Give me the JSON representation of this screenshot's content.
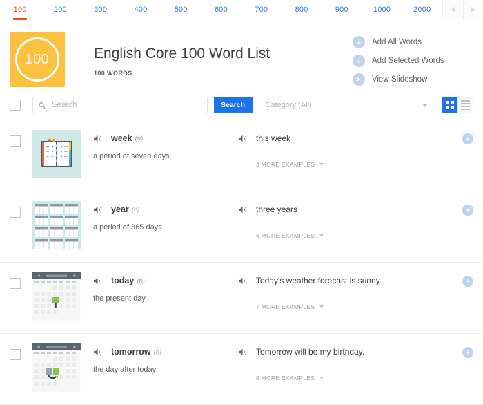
{
  "tabs": {
    "items": [
      {
        "label": "100",
        "active": true
      },
      {
        "label": "200",
        "active": false
      },
      {
        "label": "300",
        "active": false
      },
      {
        "label": "400",
        "active": false
      },
      {
        "label": "500",
        "active": false
      },
      {
        "label": "600",
        "active": false
      },
      {
        "label": "700",
        "active": false
      },
      {
        "label": "800",
        "active": false
      },
      {
        "label": "900",
        "active": false
      },
      {
        "label": "1000",
        "active": false
      },
      {
        "label": "2000",
        "active": false
      }
    ],
    "prev_icon": "chevron-left-icon",
    "next_icon": "chevron-right-icon"
  },
  "header": {
    "badge_number": "100",
    "title": "English Core 100 Word List",
    "word_count": "100 WORDS",
    "actions": [
      {
        "icon": "plus-icon",
        "label": "Add All Words"
      },
      {
        "icon": "plus-icon",
        "label": "Add Selected Words"
      },
      {
        "icon": "play-icon",
        "label": "View Slideshow"
      }
    ]
  },
  "toolbar": {
    "select_all_checkbox": "",
    "search_placeholder": "Search",
    "search_value": "",
    "search_button": "Search",
    "category_value": "Category (All)",
    "grid_view_label": "grid-view",
    "list_view_label": "list-view",
    "active_view": "grid"
  },
  "colors": {
    "accent_orange": "#f4511e",
    "badge_yellow": "#fcc13f",
    "link_blue": "#3b78e7",
    "button_blue": "#1a73e8",
    "thumb_teal": "#cfe9e6",
    "add_blue": "#bed4ee"
  },
  "rows": [
    {
      "word": "week",
      "pos": "(n)",
      "definition": "a period of seven days",
      "example": "this week",
      "more_examples": "3 MORE EXAMPLES",
      "thumbnail": "open-planner-notebook-image",
      "speaker_icon": "speaker-icon",
      "add_icon": "plus-icon"
    },
    {
      "word": "year",
      "pos": "(n)",
      "definition": "a period of 365 days",
      "example": "three years",
      "more_examples": "6 MORE EXAMPLES",
      "thumbnail": "twelve-month-calendar-grid-image",
      "speaker_icon": "speaker-icon",
      "add_icon": "plus-icon"
    },
    {
      "word": "today",
      "pos": "(n)",
      "definition": "the present day",
      "example": "Today's weather forecast is sunny.",
      "more_examples": "7 MORE EXAMPLES",
      "thumbnail": "month-calendar-current-day-image",
      "speaker_icon": "speaker-icon",
      "add_icon": "plus-icon"
    },
    {
      "word": "tomorrow",
      "pos": "(n)",
      "definition": "the day after today",
      "example": "Tomorrow will be my birthday.",
      "more_examples": "8 MORE EXAMPLES",
      "thumbnail": "month-calendar-next-day-image",
      "speaker_icon": "speaker-icon",
      "add_icon": "plus-icon"
    }
  ]
}
